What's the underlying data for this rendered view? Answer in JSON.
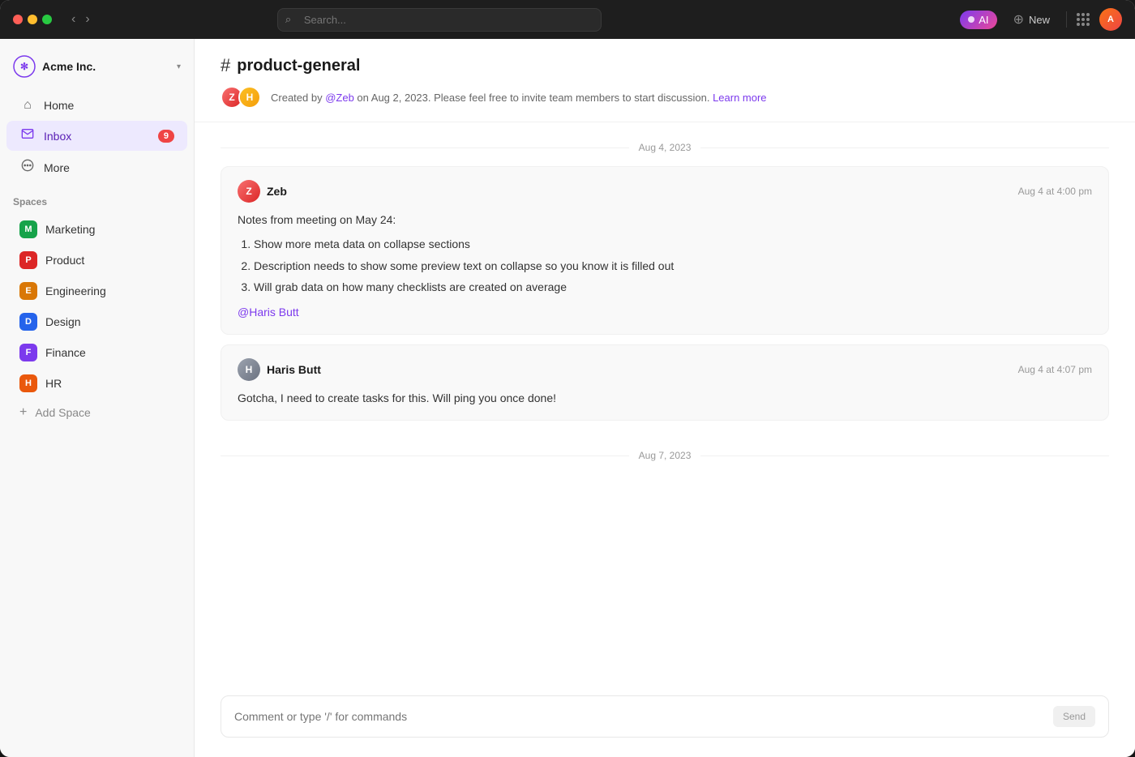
{
  "titlebar": {
    "search_placeholder": "Search...",
    "ai_label": "AI",
    "new_label": "New"
  },
  "sidebar": {
    "workspace": {
      "name": "Acme Inc.",
      "chevron": "▾"
    },
    "nav": [
      {
        "id": "home",
        "label": "Home",
        "icon": "⌂",
        "active": false
      },
      {
        "id": "inbox",
        "label": "Inbox",
        "icon": "✉",
        "active": true,
        "badge": "9"
      },
      {
        "id": "more",
        "label": "More",
        "icon": "⊙",
        "active": false
      }
    ],
    "spaces_label": "Spaces",
    "spaces": [
      {
        "id": "marketing",
        "label": "Marketing",
        "letter": "M",
        "color": "#16a34a"
      },
      {
        "id": "product",
        "label": "Product",
        "letter": "P",
        "color": "#dc2626"
      },
      {
        "id": "engineering",
        "label": "Engineering",
        "letter": "E",
        "color": "#d97706"
      },
      {
        "id": "design",
        "label": "Design",
        "letter": "D",
        "color": "#2563eb"
      },
      {
        "id": "finance",
        "label": "Finance",
        "letter": "F",
        "color": "#7c3aed"
      },
      {
        "id": "hr",
        "label": "HR",
        "letter": "H",
        "color": "#ea580c"
      }
    ],
    "add_space_label": "Add Space"
  },
  "channel": {
    "name": "product-general",
    "meta_prefix": "Created by ",
    "meta_author": "@Zeb",
    "meta_suffix": " on Aug 2, 2023. Please feel free to invite team members to start discussion. ",
    "learn_more": "Learn more"
  },
  "messages": [
    {
      "date_divider": "Aug 4, 2023",
      "id": "msg1",
      "author": "Zeb",
      "avatar_color": "#dc2626",
      "time": "Aug 4 at 4:00 pm",
      "body_intro": "Notes from meeting on May 24:",
      "list_items": [
        "Show more meta data on collapse sections",
        "Description needs to show some preview text on collapse so you know it is filled out",
        "Will grab data on how many checklists are created on average"
      ],
      "mention": "@Haris Butt"
    },
    {
      "date_divider": null,
      "id": "msg2",
      "author": "Haris Butt",
      "avatar_color": "#6b7280",
      "time": "Aug 4 at 4:07 pm",
      "body_text": "Gotcha, I need to create tasks for this. Will ping you once done!",
      "list_items": []
    }
  ],
  "second_date_divider": "Aug 7, 2023",
  "comment_box": {
    "placeholder": "Comment or type '/' for commands",
    "send_label": "Send"
  }
}
